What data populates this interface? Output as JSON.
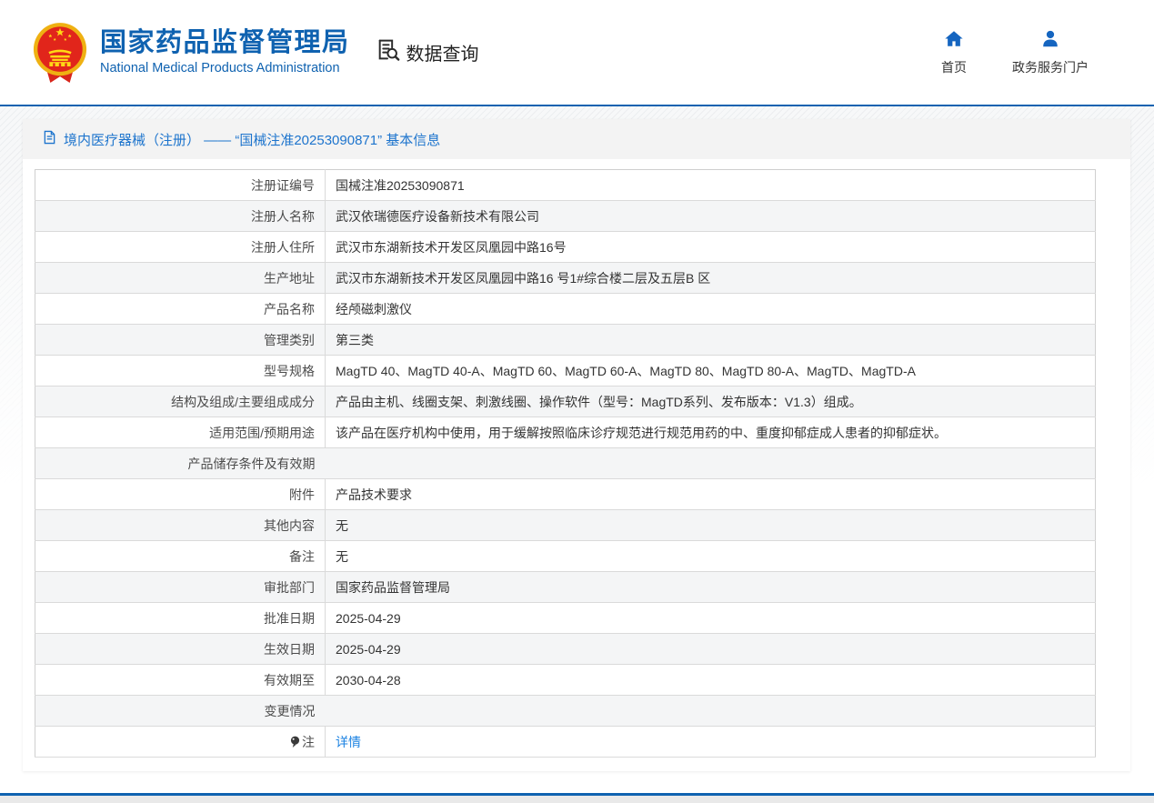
{
  "colors": {
    "accent_blue": "#0f62b0",
    "icon_blue": "#1565c0",
    "breadcrumb_blue": "#1d74cd",
    "link_blue": "#1b82e2",
    "row_alt_bg": "#f4f5f6"
  },
  "header": {
    "logo": "china-national-emblem",
    "title": "国家药品监督管理局",
    "subtitle": "National Medical Products Administration",
    "section_label": "数据查询",
    "nav": [
      {
        "id": "home",
        "label": "首页",
        "icon": "home-icon"
      },
      {
        "id": "gov-portal",
        "label": "政务服务门户",
        "icon": "user-icon"
      }
    ]
  },
  "breadcrumb": {
    "icon": "document-icon",
    "text": "境内医疗器械（注册） —— “国械注准20253090871” 基本信息"
  },
  "table": {
    "rows": [
      {
        "label": "注册证编号",
        "value": "国械注准20253090871"
      },
      {
        "label": "注册人名称",
        "value": "武汉依瑞德医疗设备新技术有限公司"
      },
      {
        "label": "注册人住所",
        "value": "武汉市东湖新技术开发区凤凰园中路16号"
      },
      {
        "label": "生产地址",
        "value": "武汉市东湖新技术开发区凤凰园中路16 号1#综合楼二层及五层B 区"
      },
      {
        "label": "产品名称",
        "value": "经颅磁刺激仪"
      },
      {
        "label": "管理类别",
        "value": "第三类"
      },
      {
        "label": "型号规格",
        "value": "MagTD 40、MagTD 40-A、MagTD 60、MagTD 60-A、MagTD 80、MagTD 80-A、MagTD、MagTD-A"
      },
      {
        "label": "结构及组成/主要组成成分",
        "value": "产品由主机、线圈支架、刺激线圈、操作软件（型号：MagTD系列、发布版本：V1.3）组成。"
      },
      {
        "label": "适用范围/预期用途",
        "value": "该产品在医疗机构中使用，用于缓解按照临床诊疗规范进行规范用药的中、重度抑郁症成人患者的抑郁症状。"
      },
      {
        "label": "产品储存条件及有效期",
        "value": ""
      },
      {
        "label": "附件",
        "value": "产品技术要求"
      },
      {
        "label": "其他内容",
        "value": "无"
      },
      {
        "label": "备注",
        "value": "无"
      },
      {
        "label": "审批部门",
        "value": "国家药品监督管理局"
      },
      {
        "label": "批准日期",
        "value": "2025-04-29"
      },
      {
        "label": "生效日期",
        "value": "2025-04-29"
      },
      {
        "label": "有效期至",
        "value": "2030-04-28"
      },
      {
        "label": "变更情况",
        "value": ""
      },
      {
        "label": "注",
        "value": "详情",
        "link": true,
        "label_icon": "note-balloon-icon"
      }
    ]
  }
}
